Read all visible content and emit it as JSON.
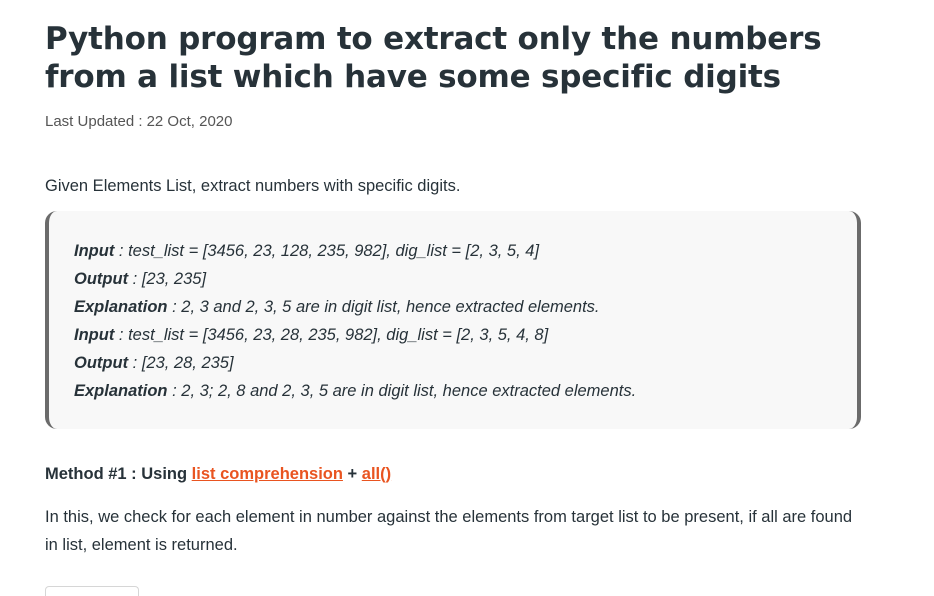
{
  "article": {
    "title": "Python program to extract only the numbers from a list which have some specific digits",
    "updated_label": "Last Updated :",
    "updated_date": "22 Oct, 2020",
    "intro": "Given Elements List, extract numbers with specific digits."
  },
  "example": [
    {
      "key": "Input",
      "text": " : test_list = [3456, 23, 128, 235, 982], dig_list = [2, 3, 5, 4]"
    },
    {
      "key": "Output",
      "text": " : [23, 235]"
    },
    {
      "key": "Explanation",
      "text": " : 2, 3 and 2, 3, 5 are in digit list, hence extracted elements."
    },
    {
      "key": "Input",
      "text": " : test_list = [3456, 23, 28, 235, 982], dig_list = [2, 3, 5, 4, 8]"
    },
    {
      "key": "Output",
      "text": " : [23, 28, 235]"
    },
    {
      "key": "Explanation",
      "text": " : 2, 3; 2, 8 and 2, 3, 5 are in digit list, hence extracted elements."
    }
  ],
  "method": {
    "prefix": "Method #1 : Using ",
    "link1": "list comprehension",
    "joiner": " + ",
    "link2": "all()"
  },
  "paragraph": "In this, we check for each element in number against the elements from target list to be present, if all are found in list, element  is returned.",
  "colors": {
    "link": "#e95420",
    "text": "#273239",
    "box_background": "#f8f8f8",
    "box_border": "#6b6b6b"
  }
}
